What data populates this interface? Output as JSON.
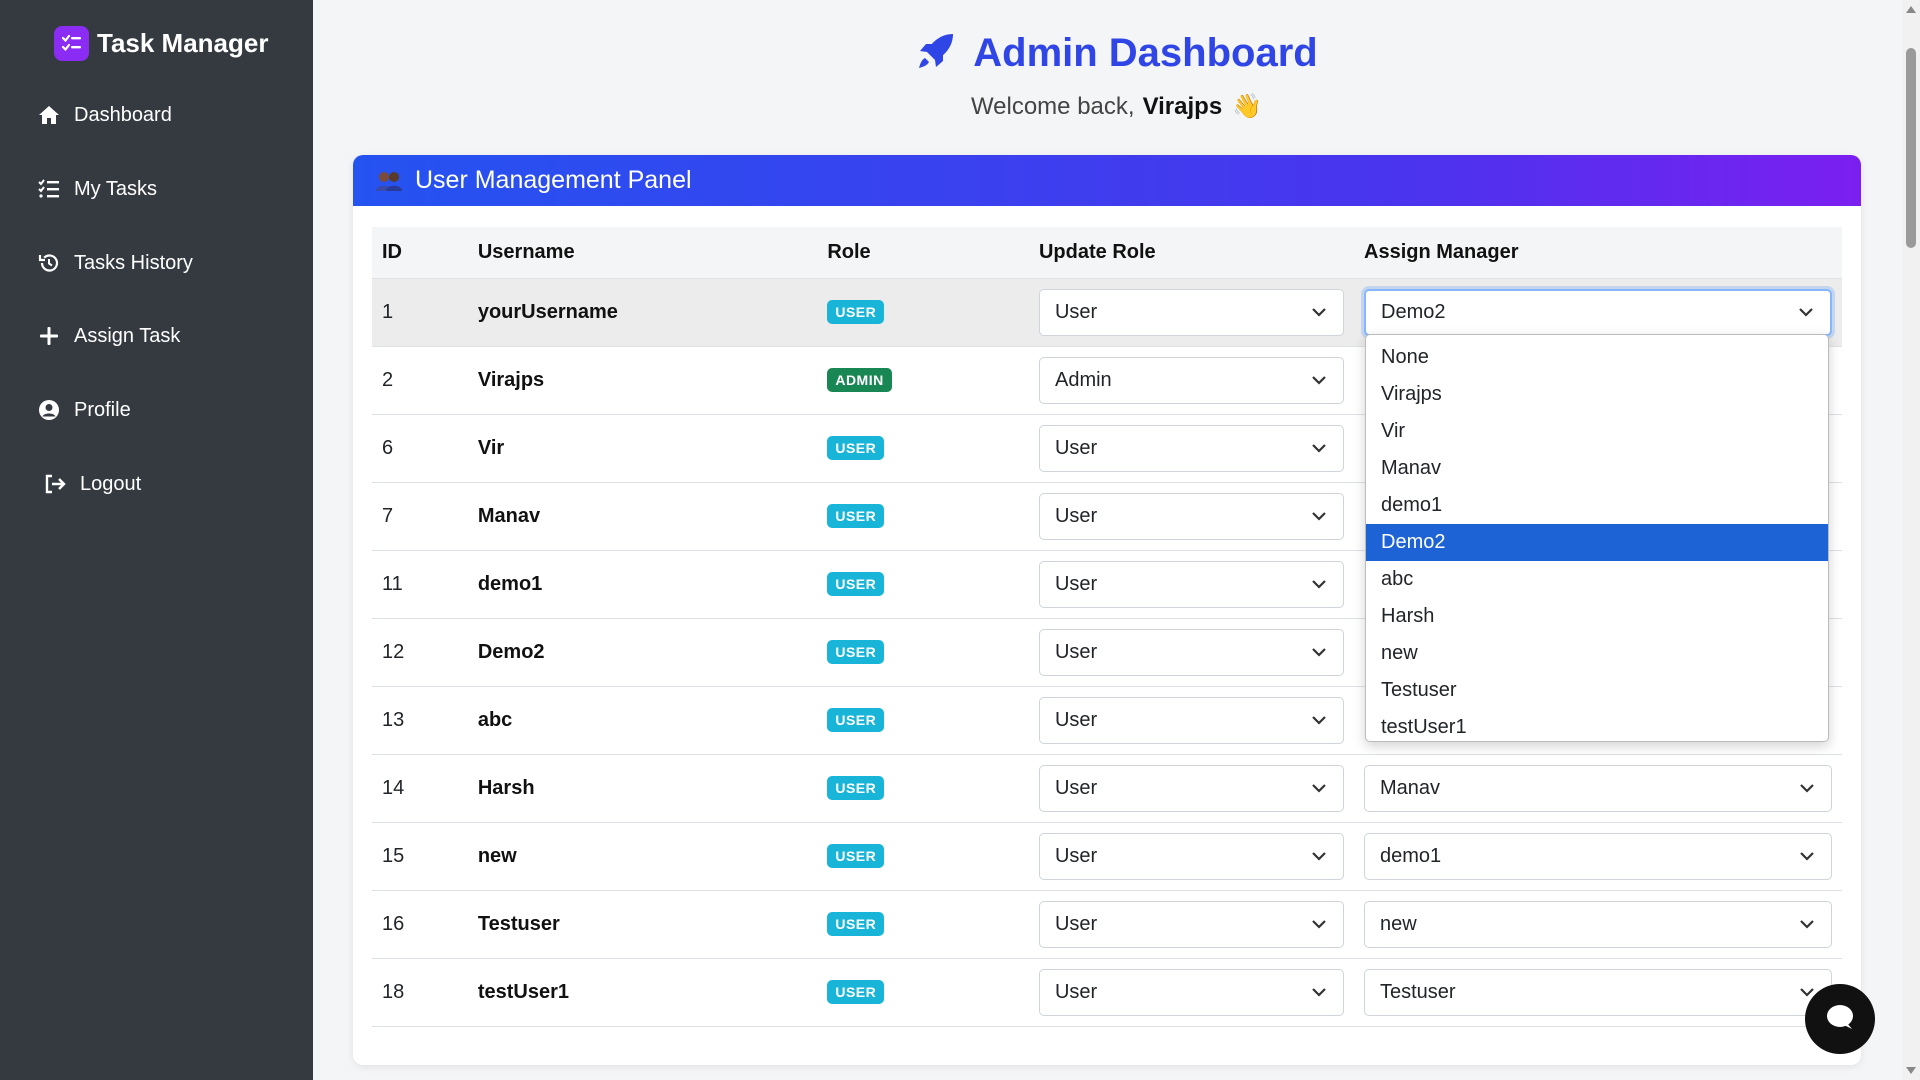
{
  "sidebar": {
    "brand": "Task Manager",
    "items": [
      {
        "label": "Dashboard",
        "icon": "home-icon"
      },
      {
        "label": "My Tasks",
        "icon": "list-icon"
      },
      {
        "label": "Tasks History",
        "icon": "history-icon"
      },
      {
        "label": "Assign Task",
        "icon": "plus-icon"
      },
      {
        "label": "Profile",
        "icon": "user-circle-icon"
      },
      {
        "label": "Logout",
        "icon": "logout-icon"
      }
    ]
  },
  "header": {
    "title": "Admin Dashboard",
    "welcome_prefix": "Welcome back,",
    "username": "Virajps",
    "wave": "👋"
  },
  "panel": {
    "title": "User Management Panel",
    "columns": [
      "ID",
      "Username",
      "Role",
      "Update Role",
      "Assign Manager"
    ]
  },
  "rows": [
    {
      "id": "1",
      "username": "yourUsername",
      "role": "USER",
      "update_role": "User",
      "manager": "Demo2"
    },
    {
      "id": "2",
      "username": "Virajps",
      "role": "ADMIN",
      "update_role": "Admin",
      "manager": ""
    },
    {
      "id": "6",
      "username": "Vir",
      "role": "USER",
      "update_role": "User",
      "manager": ""
    },
    {
      "id": "7",
      "username": "Manav",
      "role": "USER",
      "update_role": "User",
      "manager": ""
    },
    {
      "id": "11",
      "username": "demo1",
      "role": "USER",
      "update_role": "User",
      "manager": ""
    },
    {
      "id": "12",
      "username": "Demo2",
      "role": "USER",
      "update_role": "User",
      "manager": ""
    },
    {
      "id": "13",
      "username": "abc",
      "role": "USER",
      "update_role": "User",
      "manager": ""
    },
    {
      "id": "14",
      "username": "Harsh",
      "role": "USER",
      "update_role": "User",
      "manager": "Manav"
    },
    {
      "id": "15",
      "username": "new",
      "role": "USER",
      "update_role": "User",
      "manager": "demo1"
    },
    {
      "id": "16",
      "username": "Testuser",
      "role": "USER",
      "update_role": "User",
      "manager": "new"
    },
    {
      "id": "18",
      "username": "testUser1",
      "role": "USER",
      "update_role": "User",
      "manager": "Testuser"
    }
  ],
  "manager_dropdown": {
    "options": [
      "None",
      "Virajps",
      "Vir",
      "Manav",
      "demo1",
      "Demo2",
      "abc",
      "Harsh",
      "new",
      "Testuser",
      "testUser1"
    ],
    "selected": "Demo2"
  },
  "colors": {
    "sidebar_bg": "#343a40",
    "title_blue": "#2f45e6",
    "badge_user": "#19b5d8",
    "badge_admin": "#198754",
    "dropdown_selected": "#1d63d6"
  }
}
